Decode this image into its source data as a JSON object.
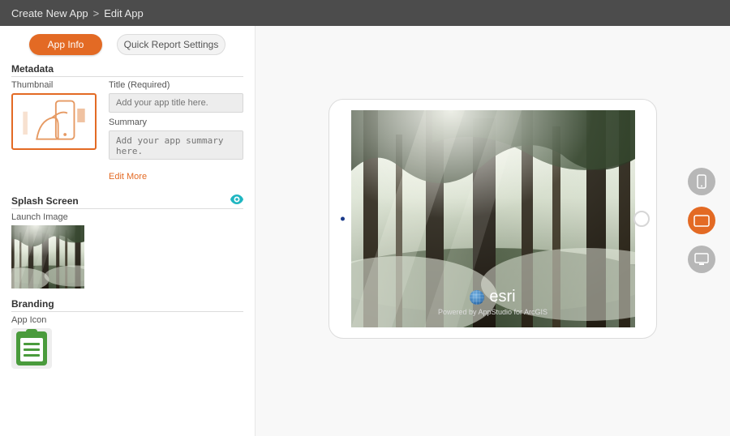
{
  "breadcrumb": {
    "root": "Create New App",
    "current": "Edit App"
  },
  "tabs": {
    "info": "App Info",
    "qr": "Quick Report Settings"
  },
  "metadata": {
    "section": "Metadata",
    "thumb_label": "Thumbnail",
    "title_label": "Title (Required)",
    "title_placeholder": "Add your app title here.",
    "summary_label": "Summary",
    "summary_placeholder": "Add your app summary here.",
    "edit_more": "Edit More"
  },
  "splash": {
    "section": "Splash Screen",
    "launch_label": "Launch Image"
  },
  "branding": {
    "section": "Branding",
    "icon_label": "App Icon"
  },
  "preview": {
    "logo_text": "esri",
    "tagline": "Powered by AppStudio for ArcGIS"
  },
  "device_rail": {
    "phone": "phone",
    "tablet": "tablet",
    "desktop": "desktop",
    "active": "tablet"
  }
}
